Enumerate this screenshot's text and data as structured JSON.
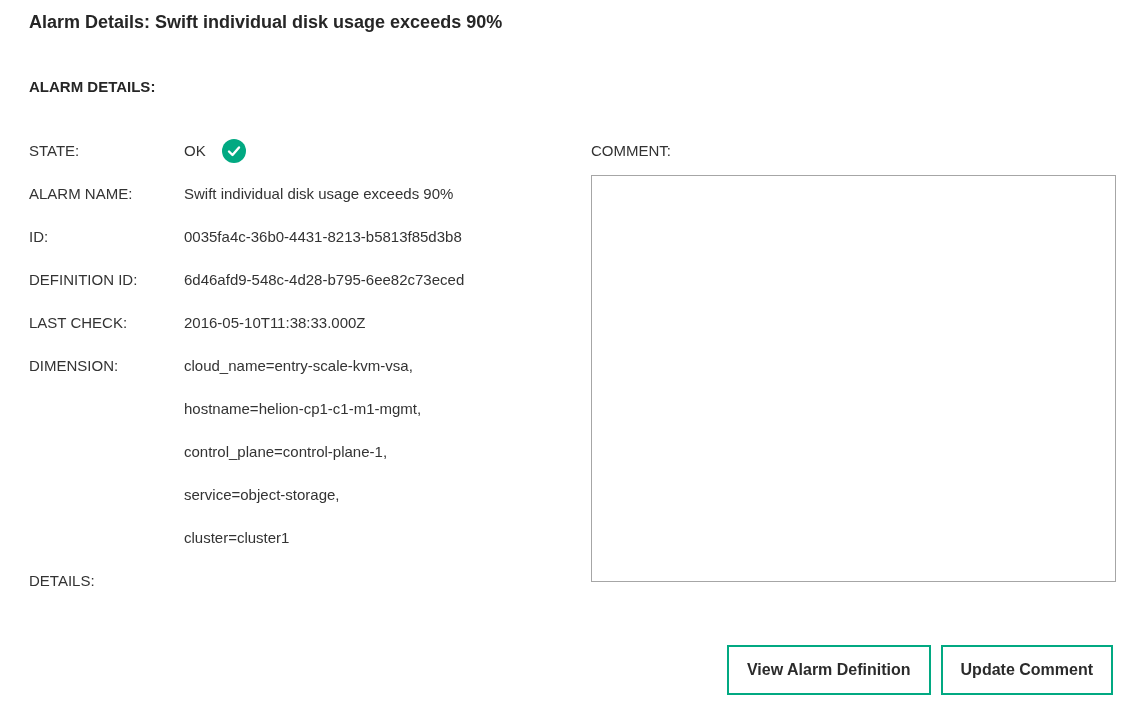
{
  "title": "Alarm Details: Swift individual disk usage exceeds 90%",
  "section_heading": "ALARM DETAILS:",
  "fields": [
    {
      "kind": "state",
      "label": "STATE:",
      "value": "OK",
      "ok": true
    },
    {
      "kind": "text",
      "label": "ALARM NAME:",
      "value": "Swift individual disk usage exceeds 90%"
    },
    {
      "kind": "text",
      "label": "ID:",
      "value": "0035fa4c-36b0-4431-8213-b5813f85d3b8"
    },
    {
      "kind": "text",
      "label": "DEFINITION ID:",
      "value": "6d46afd9-548c-4d28-b795-6ee82c73eced"
    },
    {
      "kind": "text",
      "label": "LAST CHECK:",
      "value": "2016-05-10T11:38:33.000Z"
    },
    {
      "kind": "list",
      "label": "DIMENSION:",
      "values": [
        "cloud_name=entry-scale-kvm-vsa,",
        "hostname=helion-cp1-c1-m1-mgmt,",
        "control_plane=control-plane-1,",
        "service=object-storage,",
        "cluster=cluster1"
      ]
    },
    {
      "kind": "text",
      "label": "DETAILS:"
    }
  ],
  "comment": {
    "label": "COMMENT:"
  },
  "buttons": [
    "View Alarm Definition",
    "Update Comment"
  ]
}
